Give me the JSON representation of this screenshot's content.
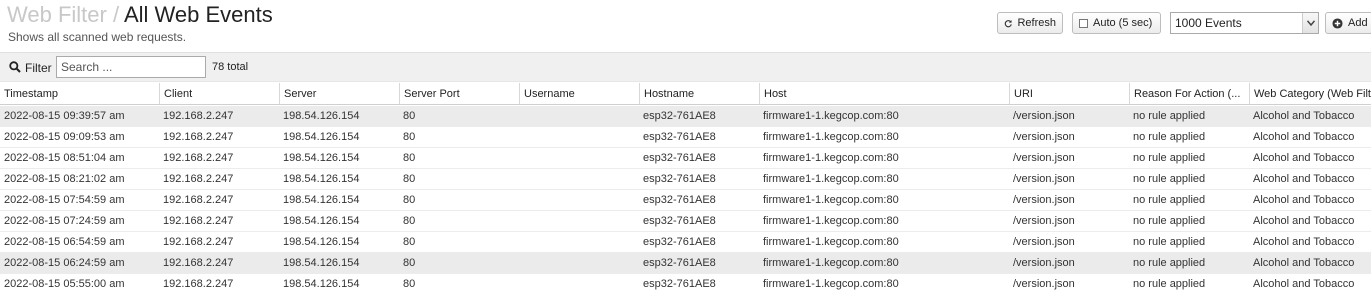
{
  "header": {
    "crumb": "Web Filter",
    "separator": " / ",
    "title": "All Web Events",
    "subtitle": "Shows all scanned web requests."
  },
  "toolbar": {
    "refresh_label": "Refresh",
    "auto_label": "Auto (5 sec)",
    "events_select": "1000 Events",
    "add_label": "Add"
  },
  "filter": {
    "label": "Filter",
    "placeholder": "Search ...",
    "total": "78 total"
  },
  "table": {
    "columns": [
      "Timestamp",
      "Client",
      "Server",
      "Server Port",
      "Username",
      "Hostname",
      "Host",
      "URI",
      "Reason For Action (...",
      "Web Category (Web Filter)"
    ],
    "rows": [
      [
        "2022-08-15 09:39:57 am",
        "192.168.2.247",
        "198.54.126.154",
        "80",
        "",
        "esp32-761AE8",
        "firmware1-1.kegcop.com:80",
        "/version.json",
        "no rule applied",
        "Alcohol and Tobacco"
      ],
      [
        "2022-08-15 09:09:53 am",
        "192.168.2.247",
        "198.54.126.154",
        "80",
        "",
        "esp32-761AE8",
        "firmware1-1.kegcop.com:80",
        "/version.json",
        "no rule applied",
        "Alcohol and Tobacco"
      ],
      [
        "2022-08-15 08:51:04 am",
        "192.168.2.247",
        "198.54.126.154",
        "80",
        "",
        "esp32-761AE8",
        "firmware1-1.kegcop.com:80",
        "/version.json",
        "no rule applied",
        "Alcohol and Tobacco"
      ],
      [
        "2022-08-15 08:21:02 am",
        "192.168.2.247",
        "198.54.126.154",
        "80",
        "",
        "esp32-761AE8",
        "firmware1-1.kegcop.com:80",
        "/version.json",
        "no rule applied",
        "Alcohol and Tobacco"
      ],
      [
        "2022-08-15 07:54:59 am",
        "192.168.2.247",
        "198.54.126.154",
        "80",
        "",
        "esp32-761AE8",
        "firmware1-1.kegcop.com:80",
        "/version.json",
        "no rule applied",
        "Alcohol and Tobacco"
      ],
      [
        "2022-08-15 07:24:59 am",
        "192.168.2.247",
        "198.54.126.154",
        "80",
        "",
        "esp32-761AE8",
        "firmware1-1.kegcop.com:80",
        "/version.json",
        "no rule applied",
        "Alcohol and Tobacco"
      ],
      [
        "2022-08-15 06:54:59 am",
        "192.168.2.247",
        "198.54.126.154",
        "80",
        "",
        "esp32-761AE8",
        "firmware1-1.kegcop.com:80",
        "/version.json",
        "no rule applied",
        "Alcohol and Tobacco"
      ],
      [
        "2022-08-15 06:24:59 am",
        "192.168.2.247",
        "198.54.126.154",
        "80",
        "",
        "esp32-761AE8",
        "firmware1-1.kegcop.com:80",
        "/version.json",
        "no rule applied",
        "Alcohol and Tobacco"
      ],
      [
        "2022-08-15 05:55:00 am",
        "192.168.2.247",
        "198.54.126.154",
        "80",
        "",
        "esp32-761AE8",
        "firmware1-1.kegcop.com:80",
        "/version.json",
        "no rule applied",
        "Alcohol and Tobacco"
      ]
    ],
    "highlighted_rows": [
      0,
      7
    ]
  },
  "icons": {
    "refresh": "refresh-icon",
    "search": "search-icon",
    "add": "plus-circle-icon",
    "dropdown": "chevron-down-icon"
  }
}
